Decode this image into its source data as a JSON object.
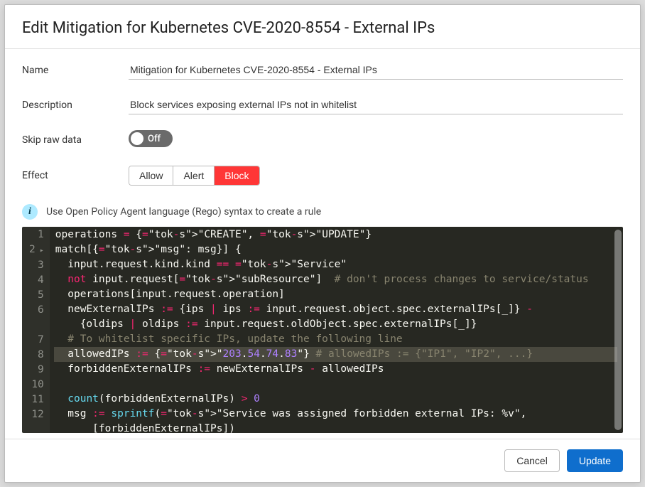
{
  "header": {
    "title": "Edit Mitigation for Kubernetes CVE-2020-8554 - External IPs"
  },
  "form": {
    "name": {
      "label": "Name",
      "value": "Mitigation for Kubernetes CVE-2020-8554 - External IPs"
    },
    "description": {
      "label": "Description",
      "value": "Block services exposing external IPs not in whitelist"
    },
    "skip_raw": {
      "label": "Skip raw data",
      "state_label": "Off",
      "on": false
    },
    "effect": {
      "label": "Effect",
      "options": [
        "Allow",
        "Alert",
        "Block"
      ],
      "selected": "Block"
    }
  },
  "info": {
    "text": "Use Open Policy Agent language (Rego) syntax to create a rule",
    "icon_glyph": "i"
  },
  "editor": {
    "highlighted_line": 8,
    "fold_markers": {
      "2": true
    },
    "lines": [
      {
        "n": 1,
        "text": "operations = {\"CREATE\", \"UPDATE\"}"
      },
      {
        "n": 2,
        "text": "match[{\"msg\": msg}] {"
      },
      {
        "n": 3,
        "text": "  input.request.kind.kind == \"Service\""
      },
      {
        "n": 4,
        "text": "  not input.request[\"subResource\"]  # don't process changes to service/status"
      },
      {
        "n": 5,
        "text": "  operations[input.request.operation]"
      },
      {
        "n": 6,
        "text": "  newExternalIPs := {ips | ips := input.request.object.spec.externalIPs[_]} - {oldips | oldips := input.request.oldObject.spec.externalIPs[_]}"
      },
      {
        "n": 7,
        "text": "  # To whitelist specific IPs, update the following line"
      },
      {
        "n": 8,
        "text": "  allowedIPs := {\"203.54.74.83\"} # allowedIPs := {\"IP1\", \"IP2\", ...}"
      },
      {
        "n": 9,
        "text": "  forbiddenExternalIPs := newExternalIPs - allowedIPs"
      },
      {
        "n": 10,
        "text": ""
      },
      {
        "n": 11,
        "text": "  count(forbiddenExternalIPs) > 0"
      },
      {
        "n": 12,
        "text": "  msg := sprintf(\"Service was assigned forbidden external IPs: %v\", [forbiddenExternalIPs])"
      }
    ]
  },
  "footer": {
    "cancel": "Cancel",
    "update": "Update"
  }
}
